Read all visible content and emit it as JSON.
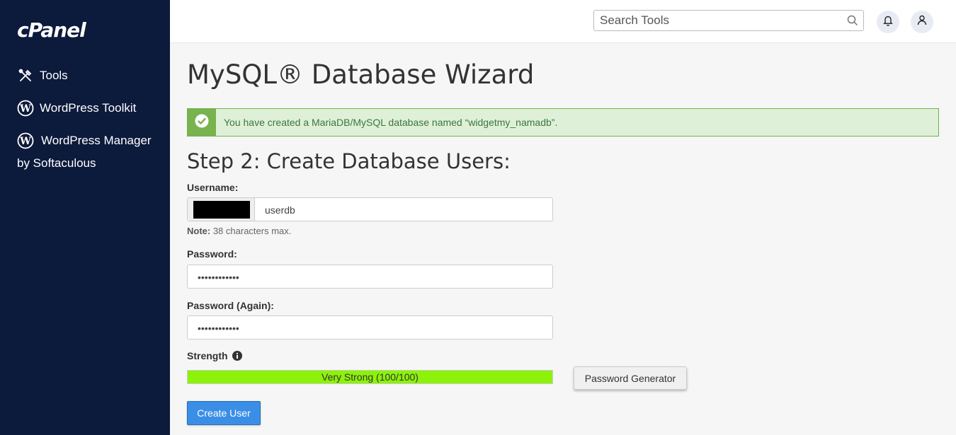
{
  "brand": {
    "logo_text": "cPanel"
  },
  "sidebar": {
    "items": [
      {
        "label": "Tools",
        "icon": "tools-icon"
      },
      {
        "label": "WordPress Toolkit",
        "icon": "wordpress-icon"
      },
      {
        "label": "WordPress Manager",
        "sublabel": "by Softaculous",
        "icon": "wordpress-icon"
      }
    ]
  },
  "topbar": {
    "search_placeholder": "Search Tools",
    "icons": [
      "search-icon",
      "bell-icon",
      "user-icon"
    ]
  },
  "page": {
    "title": "MySQL® Database Wizard",
    "alert_message": "You have created a MariaDB/MySQL database named “widgetmy_namadb”.",
    "step_title": "Step 2: Create Database Users:"
  },
  "form": {
    "username_label": "Username:",
    "username_value": "userdb",
    "note_bold": "Note:",
    "note_text": " 38 characters max.",
    "password_label": "Password:",
    "password_value": "••••••••••••",
    "password_again_label": "Password (Again):",
    "password_again_value": "••••••••••••",
    "strength_label": "Strength",
    "strength_text": "Very Strong (100/100)",
    "strength_percent": 100,
    "password_generator_label": "Password Generator",
    "create_user_label": "Create User"
  },
  "colors": {
    "sidebar_bg": "#0c1a3c",
    "alert_bg": "#dff0d8",
    "alert_accent": "#78b34f",
    "strength_fill": "#8cf20a",
    "primary_button": "#3a8ee6"
  }
}
